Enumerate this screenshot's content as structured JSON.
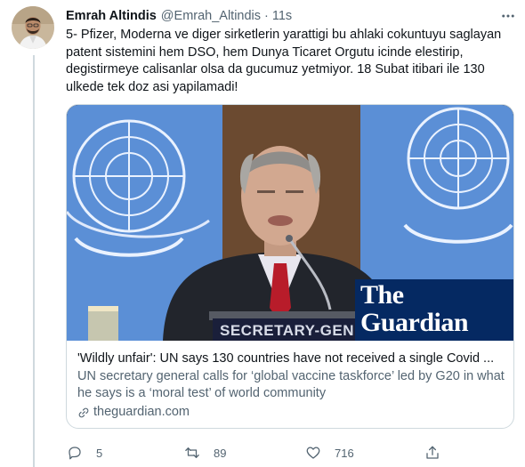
{
  "tweet": {
    "display_name": "Emrah Altindis",
    "handle": "@Emrah_Altindis",
    "separator": "·",
    "time": "11s",
    "text": "5- Pfizer, Moderna ve diger sirketlerin yarattigi bu ahlaki cokuntuyu saglayan\npatent sistemini hem DSO, hem Dunya Ticaret Orgutu icinde elestirip,\ndegistirmeye calisanlar olsa da gucumuz yetmiyor. 18 Subat itibari ile 130\nulkede tek doz asi yapilamadi!"
  },
  "card": {
    "media_overlay": {
      "brand_line1": "The",
      "brand_line2": "Guardian",
      "nameplate": "SECRETARY-GENERAL"
    },
    "title": "'Wildly unfair': UN says 130 countries have not received a single Covid ...",
    "description": "UN secretary general calls for ‘global vaccine taskforce’ led by G20 in what he says is a ‘moral test’ of world community",
    "domain": "theguardian.com"
  },
  "actions": {
    "reply_count": "5",
    "retweet_count": "89",
    "like_count": "716"
  },
  "colors": {
    "text_primary": "#0f1419",
    "text_secondary": "#536471",
    "border": "#cfd9de",
    "un_blue": "#5b8fd6",
    "guardian_blue": "#052962"
  },
  "icons": {
    "more": "more-horizontal-icon",
    "reply": "reply-icon",
    "retweet": "retweet-icon",
    "like": "heart-icon",
    "share": "share-icon",
    "link": "link-icon"
  }
}
